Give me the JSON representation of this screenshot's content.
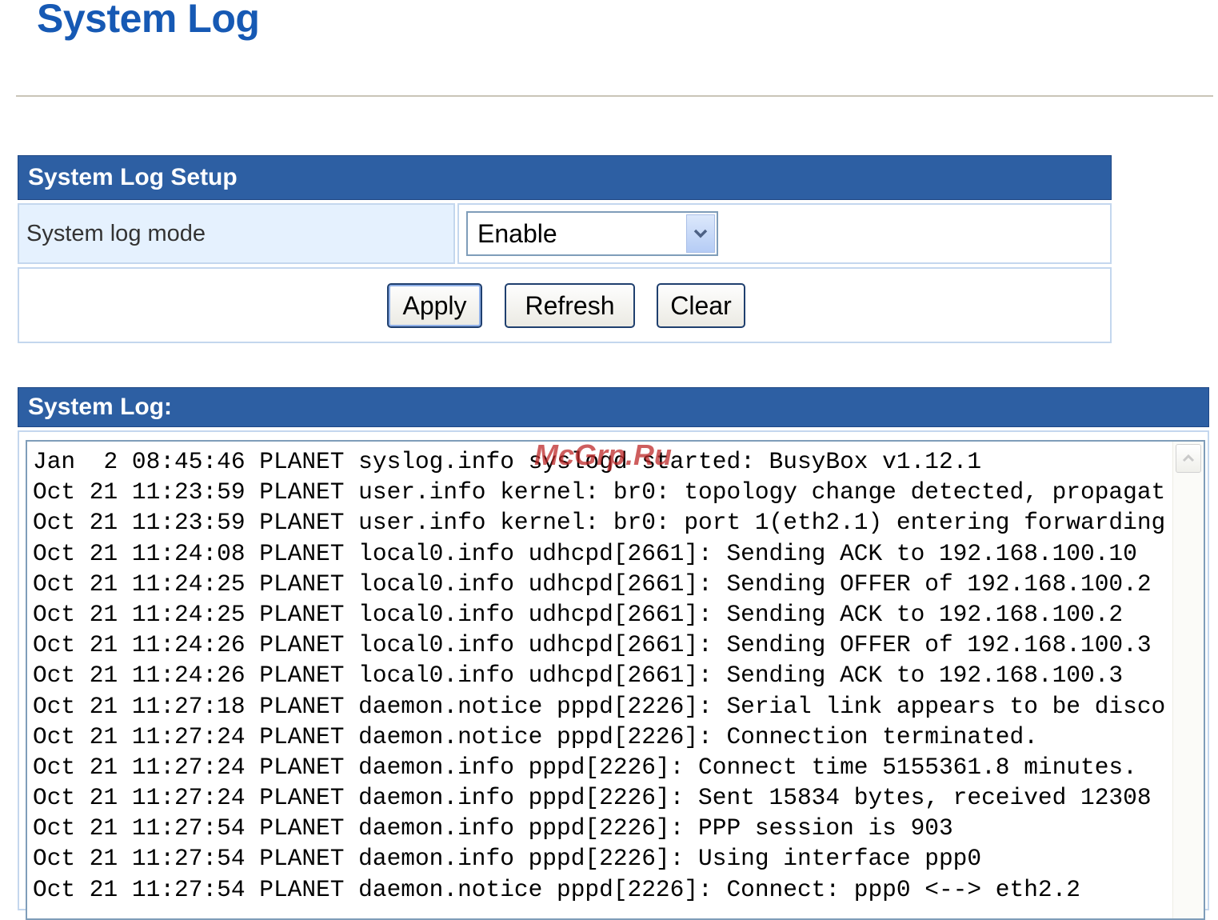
{
  "page": {
    "title": "System Log"
  },
  "setup": {
    "header": "System Log Setup",
    "mode_label": "System log mode",
    "mode_value": "Enable",
    "buttons": {
      "apply": "Apply",
      "refresh": "Refresh",
      "clear": "Clear"
    }
  },
  "log": {
    "header": "System Log:",
    "lines": [
      "Jan  2 08:45:46 PLANET syslog.info syslogd started: BusyBox v1.12.1",
      "Oct 21 11:23:59 PLANET user.info kernel: br0: topology change detected, propagat",
      "Oct 21 11:23:59 PLANET user.info kernel: br0: port 1(eth2.1) entering forwarding",
      "Oct 21 11:24:08 PLANET local0.info udhcpd[2661]: Sending ACK to 192.168.100.10",
      "Oct 21 11:24:25 PLANET local0.info udhcpd[2661]: Sending OFFER of 192.168.100.2",
      "Oct 21 11:24:25 PLANET local0.info udhcpd[2661]: Sending ACK to 192.168.100.2",
      "Oct 21 11:24:26 PLANET local0.info udhcpd[2661]: Sending OFFER of 192.168.100.3",
      "Oct 21 11:24:26 PLANET local0.info udhcpd[2661]: Sending ACK to 192.168.100.3",
      "Oct 21 11:27:18 PLANET daemon.notice pppd[2226]: Serial link appears to be disco",
      "Oct 21 11:27:24 PLANET daemon.notice pppd[2226]: Connection terminated.",
      "Oct 21 11:27:24 PLANET daemon.info pppd[2226]: Connect time 5155361.8 minutes.",
      "Oct 21 11:27:24 PLANET daemon.info pppd[2226]: Sent 15834 bytes, received 12308",
      "Oct 21 11:27:54 PLANET daemon.info pppd[2226]: PPP session is 903",
      "Oct 21 11:27:54 PLANET daemon.info pppd[2226]: Using interface ppp0",
      "Oct 21 11:27:54 PLANET daemon.notice pppd[2226]: Connect: ppp0 <--> eth2.2"
    ]
  },
  "watermark": "McGrp.Ru",
  "icons": {
    "select_arrow": "chevron-down-icon",
    "scroll_up": "chevron-up-icon"
  },
  "colors": {
    "title": "#1659b4",
    "header_bg": "#2d5fa3",
    "label_bg": "#e5f1fe"
  }
}
